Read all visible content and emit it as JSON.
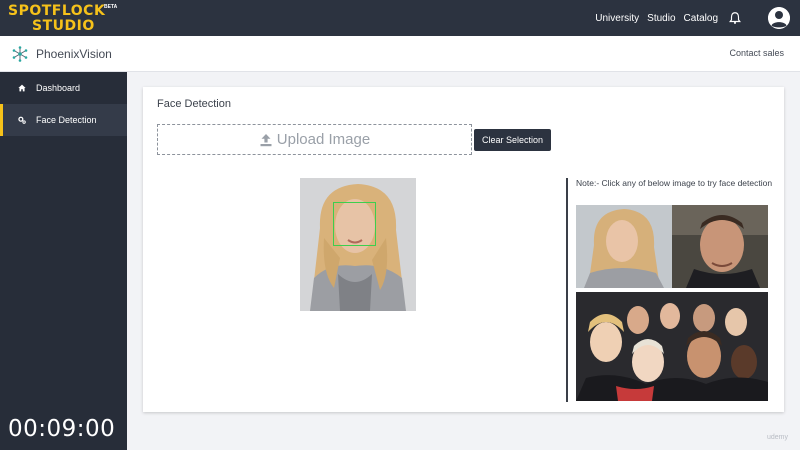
{
  "topbar": {
    "logo_line1": "SPOTFLOCK",
    "logo_line2": "STUDIO",
    "logo_badge": "BETA",
    "links": [
      "University",
      "Studio",
      "Catalog"
    ],
    "bell_icon": "bell-icon",
    "avatar_icon": "user-avatar-icon",
    "accent_color": "#f6c21a",
    "bg_color": "#2c3340"
  },
  "subbar": {
    "brand_icon": "network-nodes-icon",
    "brand_name": "PhoenixVision",
    "contact_label": "Contact sales"
  },
  "sidebar": {
    "items": [
      {
        "icon": "home-icon",
        "label": "Dashboard",
        "active": false
      },
      {
        "icon": "gears-icon",
        "label": "Face Detection",
        "active": true
      }
    ]
  },
  "main": {
    "title": "Face Detection",
    "upload_icon": "upload-icon",
    "upload_label": "Upload Image",
    "clear_label": "Clear Selection",
    "detection_box_color": "#3ccf4e",
    "note": "Note:- Click any of below image to try face detection",
    "samples": [
      "sample-image-woman",
      "sample-image-man",
      "sample-image-group-selfie"
    ]
  },
  "overlay": {
    "timer": "00:09:00"
  }
}
